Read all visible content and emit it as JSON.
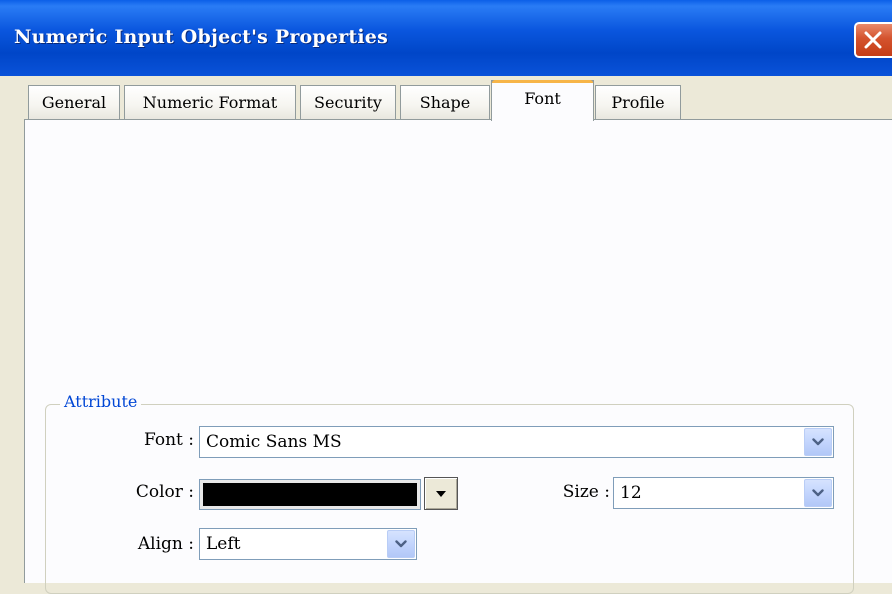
{
  "window": {
    "title": "Numeric Input Object's Properties",
    "close_icon": "close-icon"
  },
  "tabs": [
    {
      "label": "General",
      "active": false
    },
    {
      "label": "Numeric Format",
      "active": false
    },
    {
      "label": "Security",
      "active": false
    },
    {
      "label": "Shape",
      "active": false
    },
    {
      "label": "Font",
      "active": true
    },
    {
      "label": "Profile",
      "active": false
    }
  ],
  "attribute": {
    "group_label": "Attribute",
    "font_label": "Font :",
    "font_value": "Comic Sans MS",
    "color_label": "Color :",
    "color_value": "#000000",
    "size_label": "Size :",
    "size_value": "12",
    "align_label": "Align :",
    "align_value": "Left"
  },
  "colors": {
    "titlebar": "#0a56de",
    "active_tab_accent": "#f7b548",
    "group_label": "#0046d5"
  }
}
